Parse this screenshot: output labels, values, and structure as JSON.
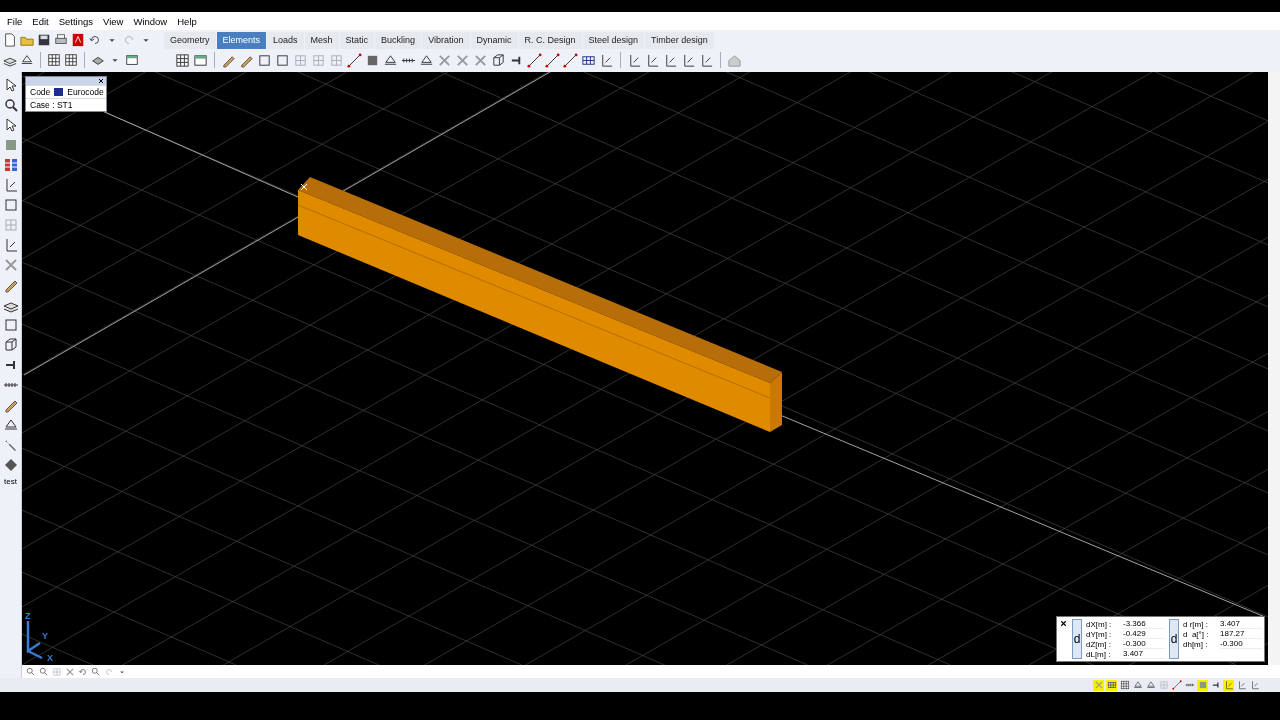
{
  "menu": [
    "File",
    "Edit",
    "Settings",
    "View",
    "Window",
    "Help"
  ],
  "tabs": [
    {
      "label": "Geometry",
      "selected": false
    },
    {
      "label": "Elements",
      "selected": true
    },
    {
      "label": "Loads",
      "selected": false
    },
    {
      "label": "Mesh",
      "selected": false
    },
    {
      "label": "Static",
      "selected": false
    },
    {
      "label": "Buckling",
      "selected": false
    },
    {
      "label": "Vibration",
      "selected": false
    },
    {
      "label": "Dynamic",
      "selected": false
    },
    {
      "label": "R. C. Design",
      "selected": false
    },
    {
      "label": "Steel design",
      "selected": false
    },
    {
      "label": "Timber design",
      "selected": false
    }
  ],
  "info_panel": {
    "code_label": "Code",
    "code_value": "Eurocode",
    "case": "Case : ST1"
  },
  "left_toolbar": {
    "label": "test"
  },
  "axes": {
    "z": "Z",
    "y": "Y",
    "x": "X"
  },
  "coordinates": {
    "left_button": "d",
    "left_rows": [
      {
        "label": "dX[m] :",
        "value": "-3.366"
      },
      {
        "label": "dY[m] :",
        "value": "-0.429"
      },
      {
        "label": "dZ[m] :",
        "value": "-0.300"
      },
      {
        "label": "dL[m] :",
        "value": "3.407"
      }
    ],
    "right_button": "d",
    "right_rows": [
      {
        "label": "d r[m] :",
        "value": "3.407"
      },
      {
        "label": "d  a[°] :",
        "value": "187.27"
      },
      {
        "label": "dh[m] :",
        "value": "-0.300"
      }
    ]
  },
  "status_toggles": [
    {
      "on": true
    },
    {
      "on": true
    },
    {
      "on": false
    },
    {
      "on": false
    },
    {
      "on": false
    },
    {
      "on": false
    },
    {
      "on": false
    },
    {
      "on": false
    },
    {
      "on": true
    },
    {
      "on": false
    },
    {
      "on": true
    },
    {
      "on": false
    },
    {
      "on": false
    }
  ]
}
